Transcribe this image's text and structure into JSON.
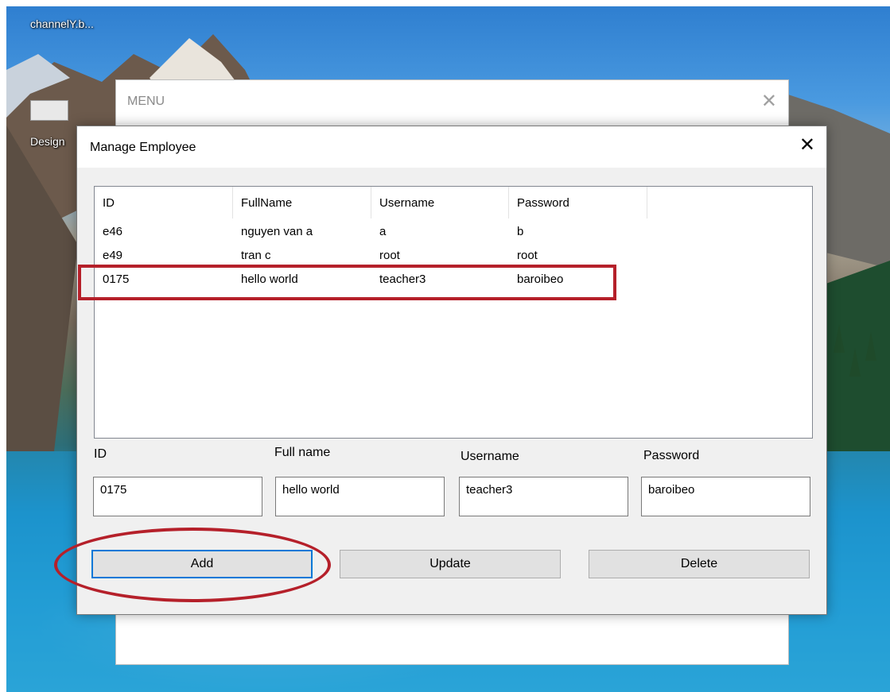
{
  "desktop": {
    "icons": [
      {
        "label": "channelY.b..."
      },
      {
        "label": "Design"
      }
    ]
  },
  "menu_window": {
    "title": "MENU",
    "close_glyph": "✕"
  },
  "dialog": {
    "title": "Manage Employee",
    "close_glyph": "✕"
  },
  "employee_table": {
    "columns": [
      "ID",
      "FullName",
      "Username",
      "Password"
    ],
    "rows": [
      [
        "e46",
        "nguyen van a",
        "a",
        "b"
      ],
      [
        "e49",
        "tran c",
        "root",
        "root"
      ],
      [
        "0175",
        "hello world",
        "teacher3",
        "baroibeo"
      ]
    ],
    "highlighted_row": 2
  },
  "form": {
    "id_label": "ID",
    "id_value": "0175",
    "fullname_label": "Full name",
    "fullname_value": "hello world",
    "username_label": "Username",
    "username_value": "teacher3",
    "password_label": "Password",
    "password_value": "baroibeo"
  },
  "buttons": {
    "add": "Add",
    "update": "Update",
    "delete": "Delete",
    "focused": "add"
  },
  "colors": {
    "annotation": "#b5202a",
    "focus": "#0078d7"
  }
}
